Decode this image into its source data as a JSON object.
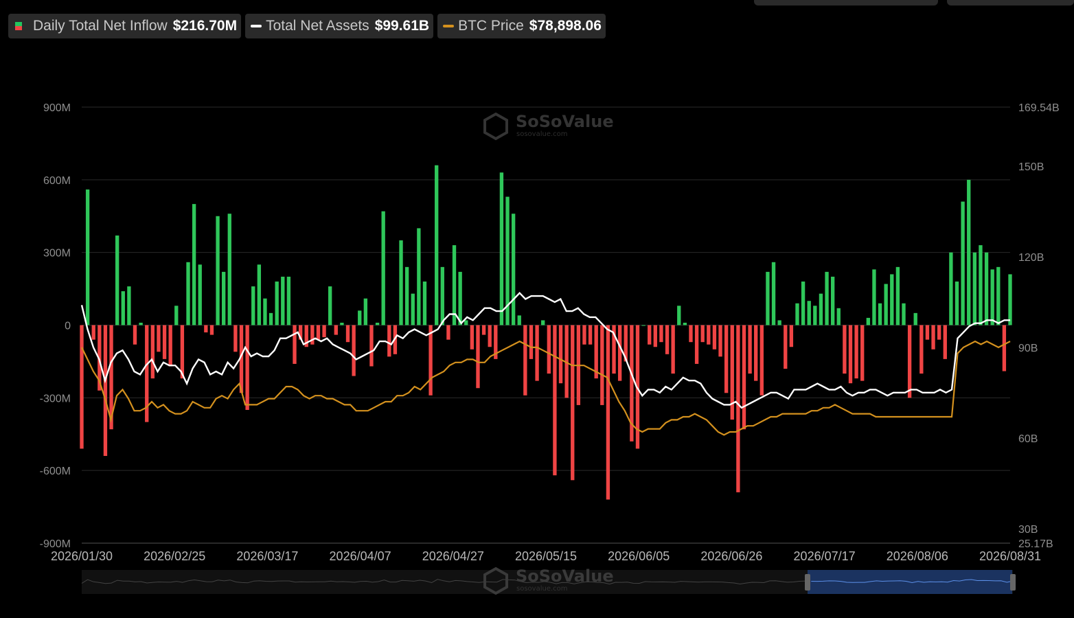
{
  "legend": {
    "inflow": {
      "label": "Daily Total Net Inflow",
      "value": "$216.70M"
    },
    "assets": {
      "label": "Total Net Assets",
      "value": "$99.61B"
    },
    "btc": {
      "label": "BTC Price",
      "value": "$78,898.06"
    }
  },
  "watermark": {
    "brand": "SoSoValue",
    "domain": "sosovalue.com"
  },
  "colors": {
    "positive": "#2fc75a",
    "negative": "#ef4444",
    "assets_line": "#ffffff",
    "btc_line": "#d4911e",
    "grid": "#2a2a2a",
    "axis_text": "#8f8f8f",
    "navigator_window": "#1d3a6e"
  },
  "chart_data": {
    "type": "bar",
    "grid": true,
    "legend_position": "top-left",
    "left_axis": {
      "ticks": [
        "900M",
        "600M",
        "300M",
        "0",
        "-300M",
        "-600M",
        "-900M"
      ],
      "ylim": [
        -900,
        900
      ],
      "unit": "M"
    },
    "right_axis": {
      "ticks": [
        "169.54B",
        "150B",
        "120B",
        "90B",
        "60B",
        "30B",
        "25.17B"
      ],
      "ylim": [
        25.17,
        169.54
      ],
      "unit": "B"
    },
    "x_ticks": [
      "2026/01/30",
      "2026/02/25",
      "2026/03/17",
      "2026/04/07",
      "2026/04/27",
      "2026/05/15",
      "2026/06/05",
      "2026/06/26",
      "2026/07/17",
      "2026/08/06",
      "2026/08/31"
    ],
    "series": [
      {
        "name": "Daily Total Net Inflow",
        "kind": "bar",
        "axis": "left",
        "values": [
          -510,
          560,
          -60,
          -270,
          -540,
          -430,
          370,
          140,
          160,
          -80,
          10,
          -400,
          -220,
          -110,
          -140,
          -170,
          80,
          -220,
          260,
          500,
          250,
          -30,
          -40,
          450,
          220,
          460,
          -110,
          -280,
          -350,
          160,
          250,
          110,
          50,
          180,
          200,
          200,
          -160,
          -60,
          -90,
          -80,
          -60,
          -50,
          160,
          -40,
          10,
          -70,
          -210,
          60,
          110,
          -170,
          10,
          470,
          -130,
          -120,
          350,
          240,
          130,
          400,
          180,
          -290,
          660,
          240,
          -60,
          330,
          220,
          20,
          -100,
          -260,
          -40,
          -90,
          -140,
          630,
          530,
          460,
          40,
          -290,
          -140,
          -230,
          20,
          -200,
          -620,
          -240,
          -300,
          -640,
          -330,
          -80,
          -80,
          -220,
          -330,
          -720,
          -200,
          -230,
          -150,
          -480,
          -510,
          0,
          -80,
          -90,
          -70,
          -120,
          -200,
          80,
          10,
          -70,
          -160,
          -70,
          -80,
          -100,
          -130,
          -280,
          -390,
          -690,
          -430,
          -200,
          -230,
          -290,
          220,
          260,
          20,
          -180,
          -90,
          90,
          180,
          100,
          80,
          130,
          220,
          200,
          70,
          -200,
          -240,
          -220,
          -230,
          30,
          230,
          90,
          170,
          210,
          240,
          90,
          -300,
          50,
          -200,
          -60,
          -100,
          -60,
          -140,
          300,
          180,
          510,
          600,
          300,
          330,
          300,
          230,
          240,
          -190,
          210
        ]
      },
      {
        "name": "Total Net Assets",
        "kind": "line",
        "axis": "right",
        "values": [
          104,
          96,
          90,
          86,
          79,
          85,
          88,
          89,
          86,
          82,
          81,
          84,
          86,
          82,
          85,
          84,
          84,
          82,
          78,
          83,
          86,
          85,
          81,
          82,
          81,
          85,
          83,
          86,
          90,
          87,
          88,
          87,
          87,
          89,
          93,
          93,
          94,
          95,
          91,
          92,
          93,
          92,
          93,
          91,
          90,
          89,
          88,
          86,
          87,
          88,
          89,
          92,
          92,
          91,
          94,
          93,
          95,
          96,
          95,
          94,
          95,
          96,
          99,
          101,
          101,
          98,
          100,
          99,
          101,
          103,
          103,
          102,
          102,
          104,
          106,
          108,
          106,
          107,
          107,
          107,
          106,
          105,
          106,
          102,
          102,
          103,
          101,
          100,
          100,
          98,
          96,
          95,
          91,
          87,
          82,
          77,
          74,
          76,
          76,
          75,
          77,
          76,
          78,
          80,
          79,
          79,
          78,
          75,
          73,
          72,
          71,
          71,
          72,
          70,
          71,
          72,
          73,
          74,
          75,
          75,
          74,
          73,
          76,
          76,
          76,
          77,
          78,
          77,
          76,
          76,
          77,
          75,
          74,
          75,
          75,
          76,
          76,
          75,
          74,
          75,
          75,
          75,
          76,
          76,
          75,
          75,
          75,
          76,
          75,
          76,
          93,
          95,
          97,
          98,
          98,
          99,
          99,
          98,
          99,
          99
        ]
      },
      {
        "name": "BTC Price",
        "kind": "line",
        "axis": "right",
        "values": [
          90,
          86,
          82,
          79,
          73,
          66,
          74,
          76,
          73,
          69,
          69,
          70,
          72,
          70,
          71,
          69,
          68,
          68,
          69,
          72,
          71,
          70,
          70,
          73,
          74,
          73,
          76,
          78,
          71,
          71,
          71,
          72,
          73,
          73,
          75,
          77,
          77,
          76,
          74,
          73,
          74,
          74,
          73,
          73,
          72,
          71,
          71,
          69,
          69,
          69,
          70,
          71,
          72,
          72,
          74,
          74,
          75,
          77,
          76,
          78,
          80,
          81,
          82,
          84,
          85,
          85,
          86,
          86,
          85,
          85,
          87,
          88,
          89,
          90,
          91,
          92,
          91,
          90,
          90,
          89,
          88,
          87,
          86,
          85,
          84,
          84,
          84,
          83,
          82,
          81,
          80,
          76,
          72,
          69,
          65,
          63,
          62,
          63,
          63,
          63,
          65,
          66,
          66,
          67,
          67,
          68,
          67,
          66,
          64,
          62,
          61,
          62,
          62,
          63,
          64,
          64,
          65,
          66,
          67,
          67,
          68,
          68,
          68,
          68,
          68,
          69,
          69,
          70,
          70,
          71,
          70,
          69,
          68,
          68,
          68,
          68,
          67,
          67,
          67,
          67,
          67,
          67,
          67,
          67,
          67,
          67,
          67,
          67,
          67,
          67,
          88,
          90,
          91,
          92,
          91,
          92,
          91,
          90,
          91,
          92
        ]
      }
    ]
  }
}
